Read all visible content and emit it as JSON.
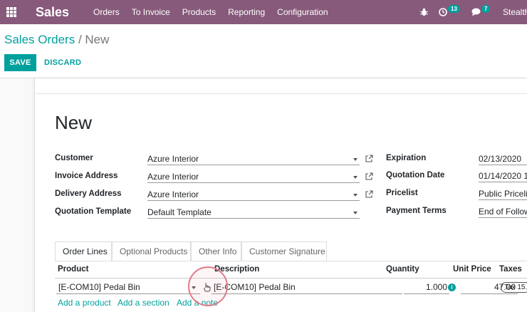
{
  "navbar": {
    "brand": "Sales",
    "menu": [
      "Orders",
      "To Invoice",
      "Products",
      "Reporting",
      "Configuration"
    ],
    "activity_count": "13",
    "message_count": "7",
    "user": "Stealth"
  },
  "breadcrumb": {
    "parent": "Sales Orders",
    "separator": "/",
    "current": "New"
  },
  "buttons": {
    "save": "SAVE",
    "discard": "DISCARD"
  },
  "form": {
    "title": "New",
    "left_fields": [
      {
        "label": "Customer",
        "value": "Azure Interior"
      },
      {
        "label": "Invoice Address",
        "value": "Azure Interior"
      },
      {
        "label": "Delivery Address",
        "value": "Azure Interior"
      },
      {
        "label": "Quotation Template",
        "value": "Default Template"
      }
    ],
    "right_fields": [
      {
        "label": "Expiration",
        "value": "02/13/2020"
      },
      {
        "label": "Quotation Date",
        "value": "01/14/2020 1"
      },
      {
        "label": "Pricelist",
        "value": "Public Pricelis"
      },
      {
        "label": "Payment Terms",
        "value": "End of Followi"
      }
    ]
  },
  "tabs": [
    "Order Lines",
    "Optional Products",
    "Other Info",
    "Customer Signature"
  ],
  "order_lines": {
    "columns": [
      "Product",
      "Description",
      "Quantity",
      "Unit Price",
      "Taxes"
    ],
    "row": {
      "product": "[E-COM10] Pedal Bin",
      "description": "[E-COM10] Pedal Bin",
      "quantity": "1.000",
      "unit_price": "47.00",
      "tax": "Tax 15."
    },
    "add_links": [
      "Add a product",
      "Add a section",
      "Add a note"
    ]
  },
  "colors": {
    "navbar": "#875a7b",
    "accent": "#00a09d"
  }
}
